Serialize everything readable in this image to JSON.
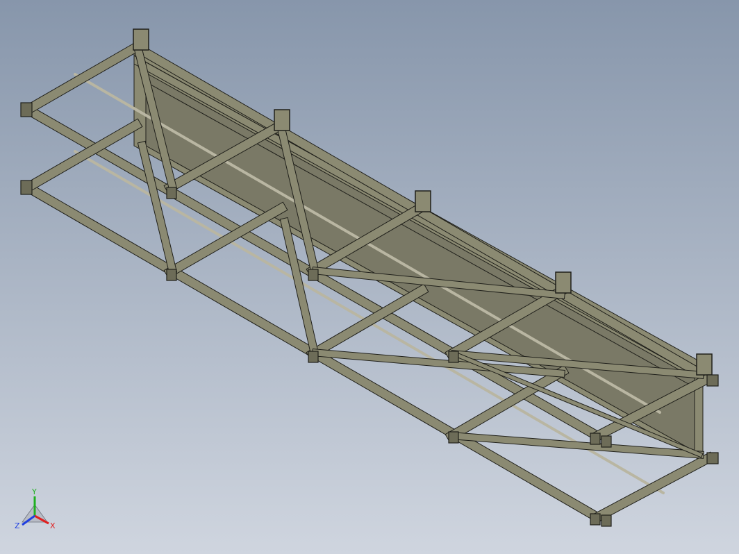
{
  "viewport": {
    "background_top": "#8796ab",
    "background_bottom": "#cfd5df",
    "model_fill": "#8b8a72",
    "model_fill_dark": "#6d6c58",
    "model_panel": "#7a7966",
    "edge_color": "#1f1f1a",
    "rod_color": "#b9b6a2"
  },
  "triad": {
    "x_label": "X",
    "y_label": "Y",
    "z_label": "Z",
    "x_color": "#e02020",
    "y_color": "#20b020",
    "z_color": "#2040e0"
  }
}
